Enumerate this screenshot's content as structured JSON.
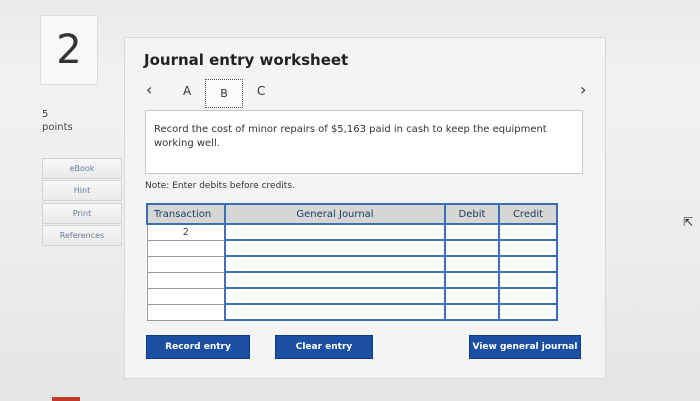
{
  "question": {
    "number": "2",
    "points_value": "5",
    "points_label": "points"
  },
  "sidebar": {
    "items": [
      {
        "label": "eBook"
      },
      {
        "label": "Hint"
      },
      {
        "label": "Print"
      },
      {
        "label": "References"
      }
    ]
  },
  "worksheet": {
    "title": "Journal entry worksheet",
    "prev_icon": "chevron-left-icon",
    "next_icon": "chevron-right-icon",
    "tabs": [
      {
        "label": "A"
      },
      {
        "label": "B",
        "selected": true
      },
      {
        "label": "C"
      }
    ],
    "question_text": "Record the cost of minor repairs of $5,163 paid in cash to keep the equipment working well.",
    "note": "Note: Enter debits before credits."
  },
  "journal_table": {
    "headers": [
      "Transaction",
      "General Journal",
      "Debit",
      "Credit"
    ],
    "rows": [
      {
        "transaction": "2",
        "account": "",
        "debit": "",
        "credit": ""
      },
      {
        "transaction": "",
        "account": "",
        "debit": "",
        "credit": ""
      },
      {
        "transaction": "",
        "account": "",
        "debit": "",
        "credit": ""
      },
      {
        "transaction": "",
        "account": "",
        "debit": "",
        "credit": ""
      },
      {
        "transaction": "",
        "account": "",
        "debit": "",
        "credit": ""
      },
      {
        "transaction": "",
        "account": "",
        "debit": "",
        "credit": ""
      }
    ]
  },
  "buttons": {
    "record_entry": "Record entry",
    "clear_entry": "Clear entry",
    "view_general_journal": "View general journal"
  },
  "colors": {
    "accent": "#1a4fa3",
    "border_blue": "#3b6fb5"
  }
}
